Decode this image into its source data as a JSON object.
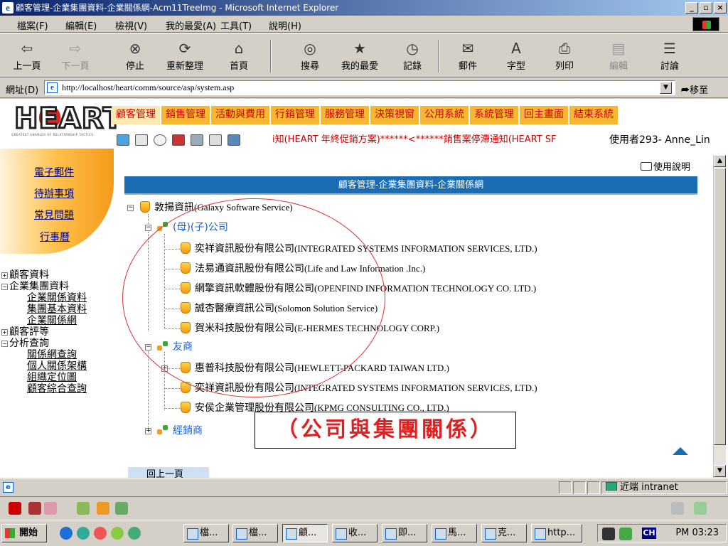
{
  "window": {
    "title": "顧客管理-企業集團資料-企業關係網-Acm11TreeImg - Microsoft Internet Explorer"
  },
  "menu": [
    "檔案(F)",
    "編輯(E)",
    "檢視(V)",
    "我的最愛(A)",
    "工具(T)",
    "說明(H)"
  ],
  "toolbar": [
    "上一頁",
    "下一頁",
    "停止",
    "重新整理",
    "首頁",
    "搜尋",
    "我的最愛",
    "記錄",
    "郵件",
    "字型",
    "列印",
    "編輯",
    "討論"
  ],
  "address": {
    "label": "網址(D)",
    "url": "http://localhost/heart/comm/source/asp/system.asp",
    "go": "移至"
  },
  "logo": {
    "word": "HEART",
    "tagline": "GREATEST ENABLER OF RELATIONSHIP TACTICS"
  },
  "quicklinks": [
    "電子郵件",
    "待辦事項",
    "常見問題",
    "行事曆"
  ],
  "lefttree": [
    {
      "label": "顧客資料",
      "type": "collapsed"
    },
    {
      "label": "企業集團資料",
      "type": "expanded"
    },
    {
      "label": "企業關係資料",
      "type": "child"
    },
    {
      "label": "集團基本資料",
      "type": "child"
    },
    {
      "label": "企業關係網",
      "type": "child"
    },
    {
      "label": "顧客評等",
      "type": "collapsed"
    },
    {
      "label": "分析查詢",
      "type": "expanded"
    },
    {
      "label": "關係網查詢",
      "type": "child"
    },
    {
      "label": "個人關係架構",
      "type": "child"
    },
    {
      "label": "組織定位圖",
      "type": "child"
    },
    {
      "label": "顧客綜合查詢",
      "type": "child"
    }
  ],
  "modules": [
    "顧客管理",
    "銷售管理",
    "活動與費用",
    "行銷管理",
    "服務管理",
    "決策視窗",
    "公用系統",
    "系統管理",
    "回主畫面",
    "結束系統"
  ],
  "marquee": "i知(HEART 年終促銷方案)******<******銷售案停滯通知(HEART SF",
  "user": "使用者293- Anne_Lin",
  "help": "使用說明",
  "panel": {
    "title": "顧客管理-企業集團資料-企業關係網",
    "root": {
      "zh": "敦揚資訊",
      "en": "(Galaxy Software Service)"
    },
    "groups": [
      {
        "label": "(母)(子)公司"
      },
      {
        "label": "友商"
      },
      {
        "label": "經銷商"
      }
    ],
    "parent_companies": [
      {
        "zh": "奕祥資訊股份有限公司",
        "en": "(INTEGRATED SYSTEMS INFORMATION SERVICES, LTD.)"
      },
      {
        "zh": "法易通資訊股份有限公司",
        "en": "(Life and Law Information .Inc.)"
      },
      {
        "zh": "網擎資訊軟體股份有限公司",
        "en": "(OPENFIND INFORMATION TECHNOLOGY CO. LTD.)"
      },
      {
        "zh": "誠杏醫療資訊公司",
        "en": "(Solomon Solution Service)"
      },
      {
        "zh": "賀米科技股份有限公司",
        "en": "(E-HERMES TECHNOLOGY CORP.)"
      }
    ],
    "competitors": [
      {
        "zh": "惠普科技股份有限公司",
        "en": "(HEWLETT-PACKARD TAIWAN LTD.)"
      },
      {
        "zh": "奕祥資訊股份有限公司",
        "en": "(INTEGRATED SYSTEMS INFORMATION SERVICES, LTD.)"
      },
      {
        "zh": "安侯企業管理股份有限公司",
        "en": "(KPMG CONSULTING CO., LTD.)"
      }
    ],
    "caption": "（公司與集團關係）",
    "prev_page": "回上一頁"
  },
  "status": {
    "zone": "近端 intranet"
  },
  "taskbar": {
    "start": "開始",
    "tasks": [
      "檔...",
      "檔...",
      "顧...",
      "收...",
      "即...",
      "馬...",
      "克...",
      "http..."
    ],
    "ime": "CH",
    "clock": "PM 03:23"
  },
  "colors": {
    "module_tab": "#f7b733",
    "panel_header": "#1a6cb3",
    "annotation": "#e02020"
  }
}
